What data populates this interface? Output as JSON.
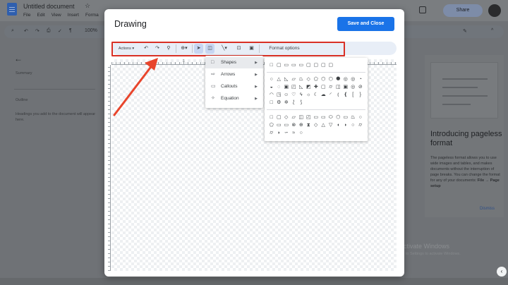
{
  "docs": {
    "title": "Untitled document",
    "menu": [
      "File",
      "Edit",
      "View",
      "Insert",
      "Forma"
    ],
    "share_label": "Share",
    "zoom": "100%",
    "left_panel": {
      "summary_label": "Summary",
      "outline_label": "Outline",
      "outline_hint": "Headings you add to the document will appear here."
    },
    "right_card": {
      "title": "Introducing pageless format",
      "body": "The pageless format allows you to use wide images and tables, and makes documents without the interruption of page breaks. You can change the format for any of your documents:",
      "menu_path": "File → Page setup",
      "dismiss_label": "Dismiss"
    }
  },
  "watermark": {
    "line1": "Activate Windows",
    "line2": "Go to Settings to activate Windows."
  },
  "dialog": {
    "title": "Drawing",
    "save_label": "Save and Close",
    "toolbar": {
      "actions_label": "Actions ▾",
      "format_options_label": "Format options"
    },
    "ruler_marks": [
      "1",
      "2"
    ],
    "insert_menu": [
      {
        "label": "Shapes",
        "icon": "square-icon",
        "glyph": "□"
      },
      {
        "label": "Arrows",
        "icon": "arrow-shape-icon",
        "glyph": "⇨"
      },
      {
        "label": "Callouts",
        "icon": "callout-icon",
        "glyph": "▭"
      },
      {
        "label": "Equation",
        "icon": "equation-icon",
        "glyph": "✧"
      }
    ]
  },
  "colors": {
    "save_button": "#1a73e8",
    "highlight": "#d93025",
    "annotation_arrow": "#e8452c"
  }
}
